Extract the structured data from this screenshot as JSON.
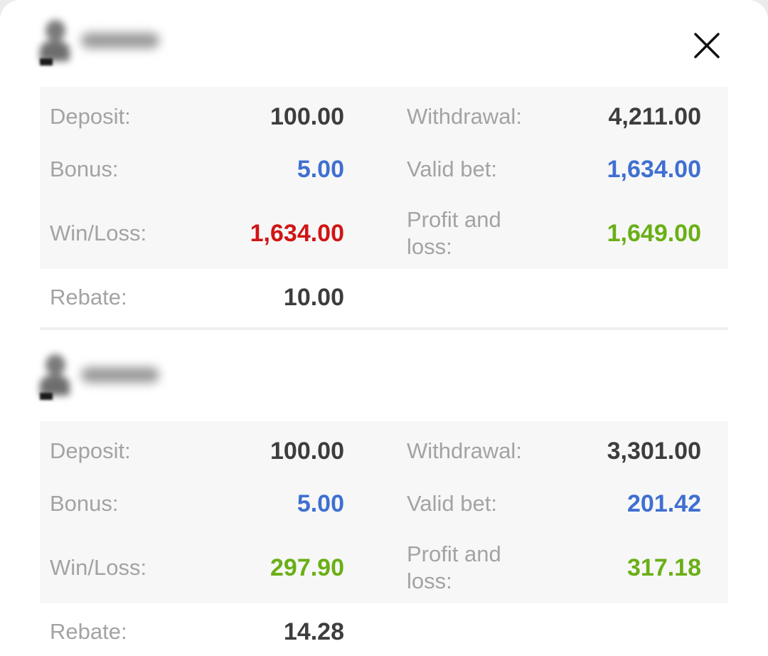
{
  "colors": {
    "default_value": "#3d3d3d",
    "blue": "#3f6fd1",
    "red": "#d01515",
    "green": "#6aaf16",
    "label": "#a3a3a3"
  },
  "close_icon": "close-icon",
  "avatar_icon": "user-avatar-icon",
  "records": [
    {
      "username": "jimqin",
      "deposit": {
        "label": "Deposit:",
        "value": "100.00",
        "color": "default_value"
      },
      "withdrawal": {
        "label": "Withdrawal:",
        "value": "4,211.00",
        "color": "default_value"
      },
      "bonus": {
        "label": "Bonus:",
        "value": "5.00",
        "color": "blue"
      },
      "valid_bet": {
        "label": "Valid bet:",
        "value": "1,634.00",
        "color": "blue"
      },
      "win_loss": {
        "label": "Win/Loss:",
        "value": "1,634.00",
        "color": "red"
      },
      "profit_and_loss": {
        "label": "Profit and loss:",
        "value": "1,649.00",
        "color": "green"
      },
      "rebate": {
        "label": "Rebate:",
        "value": "10.00",
        "color": "default_value"
      }
    },
    {
      "username": "vbruwnp",
      "deposit": {
        "label": "Deposit:",
        "value": "100.00",
        "color": "default_value"
      },
      "withdrawal": {
        "label": "Withdrawal:",
        "value": "3,301.00",
        "color": "default_value"
      },
      "bonus": {
        "label": "Bonus:",
        "value": "5.00",
        "color": "blue"
      },
      "valid_bet": {
        "label": "Valid bet:",
        "value": "201.42",
        "color": "blue"
      },
      "win_loss": {
        "label": "Win/Loss:",
        "value": "297.90",
        "color": "green"
      },
      "profit_and_loss": {
        "label": "Profit and loss:",
        "value": "317.18",
        "color": "green"
      },
      "rebate": {
        "label": "Rebate:",
        "value": "14.28",
        "color": "default_value"
      }
    }
  ]
}
